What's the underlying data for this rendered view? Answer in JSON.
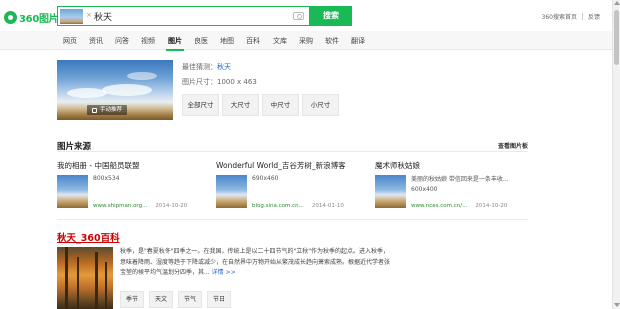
{
  "header": {
    "logo_text": "360图片",
    "query": "秋天",
    "thumb_close": "×",
    "search_button": "搜索",
    "links": [
      "360搜索首页",
      "反馈"
    ]
  },
  "nav": {
    "items": [
      "网页",
      "资讯",
      "问答",
      "视频",
      "图片",
      "良医",
      "地图",
      "百科",
      "文库",
      "采购",
      "软件",
      "翻译"
    ],
    "active": "图片"
  },
  "result": {
    "guess_label": "最佳猜测：",
    "guess_value": "秋天",
    "size_text": "图片尺寸：1000 x 463",
    "recommend_badge": "手动推荐",
    "size_buttons": [
      "全部尺寸",
      "大尺寸",
      "中尺寸",
      "小尺寸"
    ]
  },
  "sources": {
    "title": "图片来源",
    "more_link": "查看图片板",
    "items": [
      {
        "title": "我的相册 - 中国船员联盟",
        "desc": "",
        "dim": "800x534",
        "url": "www.shipman.org...",
        "date": "2014-10-20"
      },
      {
        "title": "Wonderful World_吉谷芳树_新浪博客",
        "desc": "",
        "dim": "690x460",
        "url": "blog.sina.com.cn...",
        "date": "2014-01-10"
      },
      {
        "title": "魔术师秋姑娘",
        "desc": "美丽的秋姑娘 带信回来是一条丰收...",
        "dim": "600x400",
        "url": "www.nces.com.cn/...",
        "date": "2014-10-20"
      }
    ]
  },
  "baike": {
    "title": "秋天_360百科",
    "text": "秋季，是\"春夏秋冬\"四季之一。在我国，传统上是以二十四节气的\"立秋\"作为秋季的起点。进入秋季，意味着降雨、湿度等趋于下降或减少，在自然界中万物开始从繁茂成长趋向萧索成熟。根据近代学者张宝堃的候平均气温划分四季，其...",
    "more": "详情 >>",
    "tags": [
      "季节",
      "天文",
      "节气",
      "节日"
    ]
  },
  "colors": {
    "accent": "#19b955",
    "link": "#1e66c6",
    "baike_title": "#cc0000",
    "url_green": "#2f8a2f"
  }
}
